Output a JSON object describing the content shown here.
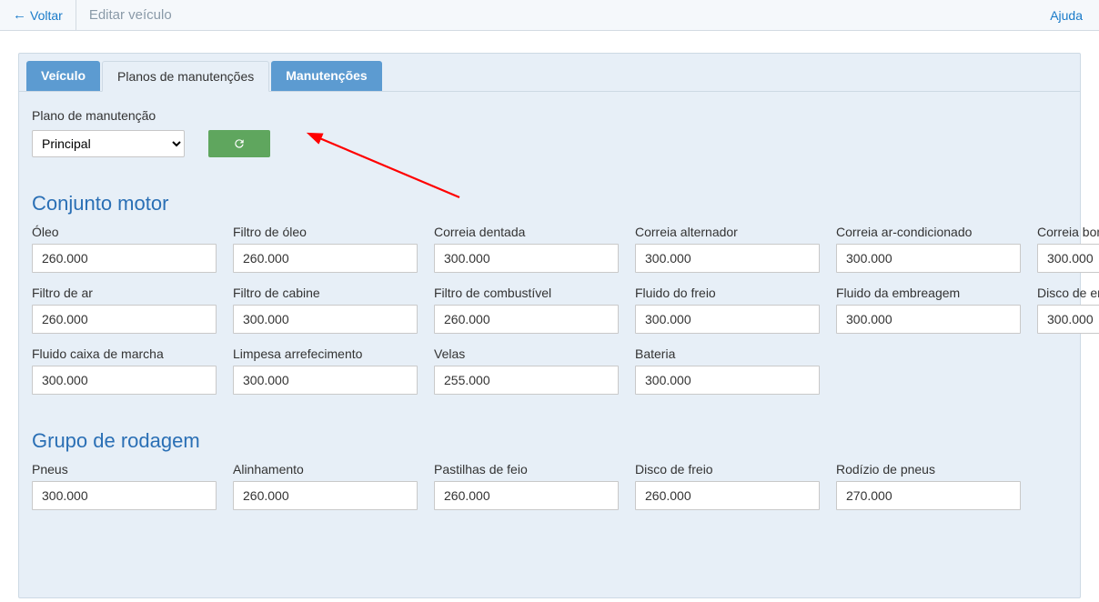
{
  "topbar": {
    "back": "Voltar",
    "title": "Editar veículo",
    "help": "Ajuda"
  },
  "tabs": [
    {
      "label": "Veículo"
    },
    {
      "label": "Planos de manutenções"
    },
    {
      "label": "Manutenções"
    }
  ],
  "plan": {
    "label": "Plano de manutenção",
    "selected": "Principal"
  },
  "sections": [
    {
      "title": "Conjunto motor",
      "fields": [
        {
          "label": "Óleo",
          "value": "260.000"
        },
        {
          "label": "Filtro de óleo",
          "value": "260.000"
        },
        {
          "label": "Correia dentada",
          "value": "300.000"
        },
        {
          "label": "Correia alternador",
          "value": "300.000"
        },
        {
          "label": "Correia ar-condicionado",
          "value": "300.000"
        },
        {
          "label": "Correia bomba d'água",
          "value": "300.000"
        },
        {
          "label": "Filtro de ar",
          "value": "260.000"
        },
        {
          "label": "Filtro de cabine",
          "value": "300.000"
        },
        {
          "label": "Filtro de combustível",
          "value": "260.000"
        },
        {
          "label": "Fluido do freio",
          "value": "300.000"
        },
        {
          "label": "Fluido da embreagem",
          "value": "300.000"
        },
        {
          "label": "Disco de empresagem",
          "value": "300.000"
        },
        {
          "label": "Fluido caixa de marcha",
          "value": "300.000"
        },
        {
          "label": "Limpesa arrefecimento",
          "value": "300.000"
        },
        {
          "label": "Velas",
          "value": "255.000"
        },
        {
          "label": "Bateria",
          "value": "300.000"
        }
      ]
    },
    {
      "title": "Grupo de rodagem",
      "fields": [
        {
          "label": "Pneus",
          "value": "300.000"
        },
        {
          "label": "Alinhamento",
          "value": "260.000"
        },
        {
          "label": "Pastilhas de feio",
          "value": "260.000"
        },
        {
          "label": "Disco de freio",
          "value": "260.000"
        },
        {
          "label": "Rodízio de pneus",
          "value": "270.000"
        }
      ]
    }
  ]
}
